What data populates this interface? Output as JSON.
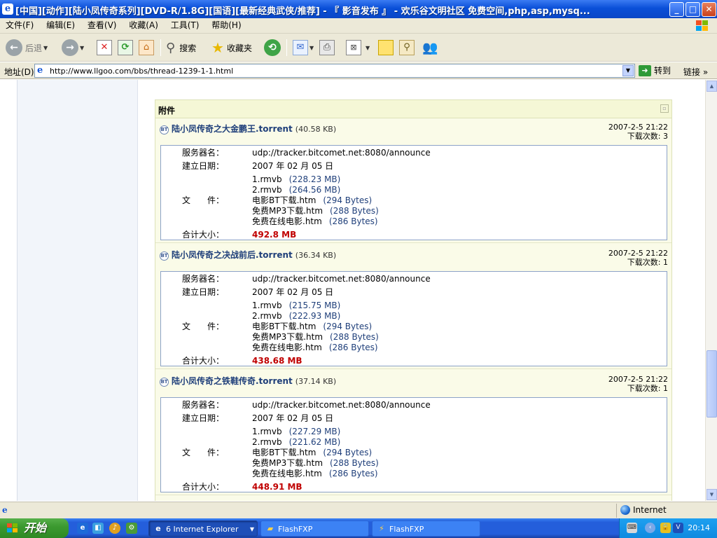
{
  "window": {
    "title": "[中国][动作][陆小凤传奇系列][DVD-R/1.8G][国语][最新经典武侠/推荐] - 『 影音发布 』 - 欢乐谷文明社区 免费空间,php,asp,mysq...",
    "min_glyph": "_",
    "max_glyph": "□",
    "close_glyph": "✕"
  },
  "menu": [
    "文件(F)",
    "编辑(E)",
    "查看(V)",
    "收藏(A)",
    "工具(T)",
    "帮助(H)"
  ],
  "toolbar": {
    "back_label": "后退",
    "search_label": "搜索",
    "favorites_label": "收藏夹"
  },
  "address": {
    "label": "地址(D)",
    "url": "http://www.llgoo.com/bbs/thread-1239-1-1.html",
    "go_label": "转到",
    "links_label": "链接"
  },
  "attachments": {
    "header": "附件",
    "field_labels": {
      "server": "服务器名：",
      "created": "建立日期：",
      "files": "文　　件：",
      "total": "合计大小："
    },
    "items": [
      {
        "name": "陆小凤传奇之大金鹏王.torrent",
        "size": "(40.58 KB)",
        "date": "2007-2-5 21:22",
        "downloads": "下载次数: 3",
        "server": "udp://tracker.bitcomet.net:8080/announce",
        "created": "2007 年 02 月 05 日",
        "files": [
          {
            "name": "1.rmvb",
            "size": "(228.23 MB)"
          },
          {
            "name": "2.rmvb",
            "size": "(264.56 MB)"
          },
          {
            "name": "电影BT下载.htm",
            "size": "(294 Bytes)"
          },
          {
            "name": "免费MP3下载.htm",
            "size": "(288 Bytes)"
          },
          {
            "name": "免费在线电影.htm",
            "size": "(286 Bytes)"
          }
        ],
        "total": "492.8 MB"
      },
      {
        "name": "陆小凤传奇之决战前后.torrent",
        "size": "(36.34 KB)",
        "date": "2007-2-5 21:22",
        "downloads": "下载次数: 1",
        "server": "udp://tracker.bitcomet.net:8080/announce",
        "created": "2007 年 02 月 05 日",
        "files": [
          {
            "name": "1.rmvb",
            "size": "(215.75 MB)"
          },
          {
            "name": "2.rmvb",
            "size": "(222.93 MB)"
          },
          {
            "name": "电影BT下载.htm",
            "size": "(294 Bytes)"
          },
          {
            "name": "免费MP3下载.htm",
            "size": "(288 Bytes)"
          },
          {
            "name": "免费在线电影.htm",
            "size": "(286 Bytes)"
          }
        ],
        "total": "438.68 MB"
      },
      {
        "name": "陆小凤传奇之铁鞋传奇.torrent",
        "size": "(37.14 KB)",
        "date": "2007-2-5 21:22",
        "downloads": "下载次数: 1",
        "server": "udp://tracker.bitcomet.net:8080/announce",
        "created": "2007 年 02 月 05 日",
        "files": [
          {
            "name": "1.rmvb",
            "size": "(227.29 MB)"
          },
          {
            "name": "2.rmvb",
            "size": "(221.62 MB)"
          },
          {
            "name": "电影BT下载.htm",
            "size": "(294 Bytes)"
          },
          {
            "name": "免费MP3下载.htm",
            "size": "(288 Bytes)"
          },
          {
            "name": "免费在线电影.htm",
            "size": "(286 Bytes)"
          }
        ],
        "total": "448.91 MB"
      }
    ]
  },
  "statusbar": {
    "zone": "Internet"
  },
  "taskbar": {
    "start_label": "开始",
    "tasks": [
      {
        "label": "6 Internet Explorer",
        "active": true
      },
      {
        "label": "FlashFXP",
        "active": false
      },
      {
        "label": "FlashFXP",
        "active": false
      }
    ],
    "clock": "20:14"
  }
}
